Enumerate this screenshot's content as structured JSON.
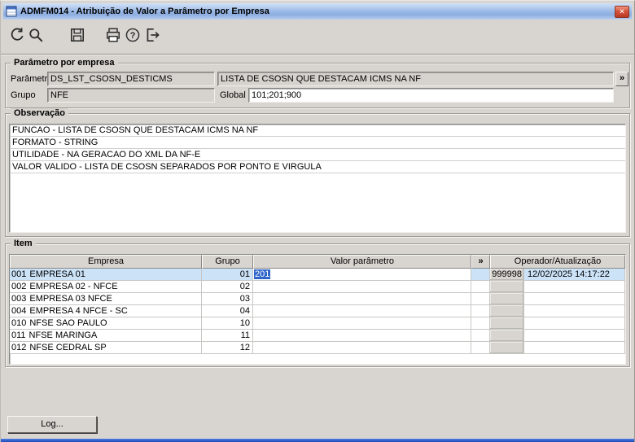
{
  "window": {
    "title": "ADMFM014 - Atribuição de Valor a Parâmetro por Empresa"
  },
  "icons": {
    "close": "✕"
  },
  "toolbar": {
    "buttons": [
      "undo",
      "search",
      "save",
      "print",
      "help",
      "exit"
    ]
  },
  "param_group": {
    "legend": "Parâmetro por empresa",
    "param_label": "Parâmetro",
    "param_code": "DS_LST_CSOSN_DESTICMS",
    "param_desc": "LISTA DE CSOSN QUE DESTACAM ICMS NA NF",
    "expand_button": "»",
    "grupo_label": "Grupo",
    "grupo_value": "NFE",
    "global_label": "Global",
    "global_value": "101;201;900"
  },
  "observacao": {
    "legend": "Observação",
    "lines": [
      "FUNCAO - LISTA DE CSOSN QUE DESTACAM ICMS NA NF",
      "FORMATO - STRING",
      "UTILIDADE - NA GERACAO DO XML DA NF-E",
      "VALOR VALIDO - LISTA DE CSOSN SEPARADOS POR PONTO E VIRGULA"
    ]
  },
  "item": {
    "legend": "Item",
    "columns": {
      "empresa": "Empresa",
      "grupo": "Grupo",
      "valor": "Valor parâmetro",
      "expand": "»",
      "operador": "Operador/Atualização"
    },
    "rows": [
      {
        "code": "001",
        "empresa": "EMPRESA 01",
        "grupo": "01",
        "valor": "201",
        "operador": "999998",
        "atualizacao": "12/02/2025 14:17:22"
      },
      {
        "code": "002",
        "empresa": "EMPRESA 02 - NFCE",
        "grupo": "02",
        "valor": "",
        "operador": "",
        "atualizacao": ""
      },
      {
        "code": "003",
        "empresa": "EMPRESA 03 NFCE",
        "grupo": "03",
        "valor": "",
        "operador": "",
        "atualizacao": ""
      },
      {
        "code": "004",
        "empresa": "EMPRESA 4 NFCE - SC",
        "grupo": "04",
        "valor": "",
        "operador": "",
        "atualizacao": ""
      },
      {
        "code": "010",
        "empresa": "NFSE SAO PAULO",
        "grupo": "10",
        "valor": "",
        "operador": "",
        "atualizacao": ""
      },
      {
        "code": "011",
        "empresa": "NFSE MARINGA",
        "grupo": "11",
        "valor": "",
        "operador": "",
        "atualizacao": ""
      },
      {
        "code": "012",
        "empresa": "NFSE CEDRAL SP",
        "grupo": "12",
        "valor": "",
        "operador": "",
        "atualizacao": ""
      }
    ]
  },
  "footer": {
    "log_button": "Log..."
  },
  "colors": {
    "selection_blue": "#2e66c9",
    "selected_row": "#cbe2f7",
    "titlebar_top": "#d2e1f6",
    "titlebar_bottom": "#8cade0",
    "close_red": "#d4523a",
    "window_bg": "#d8d5d0",
    "bottom_border_blue": "#1c4cba"
  }
}
